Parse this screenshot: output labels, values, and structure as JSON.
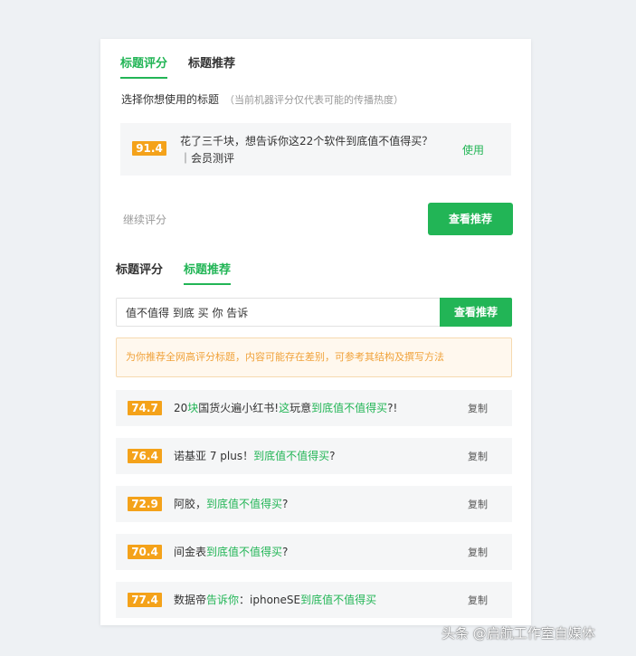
{
  "colors": {
    "accent": "#22b556",
    "score_badge": "#f4a21a",
    "notice_text": "#f0a23a"
  },
  "top_tabs": [
    {
      "label": "标题评分",
      "active": true
    },
    {
      "label": "标题推荐",
      "active": false
    }
  ],
  "select_prompt": "选择你想使用的标题",
  "select_hint": "（当前机器评分仅代表可能的传播热度）",
  "selected_title": {
    "score": "91.4",
    "text": "花了三千块，想告诉你这22个软件到底值不值得买？｜会员测评",
    "use_label": "使用"
  },
  "continue_label": "继续评分",
  "view_recommend_label": "查看推荐",
  "second_tabs": [
    {
      "label": "标题评分",
      "active": false
    },
    {
      "label": "标题推荐",
      "active": true
    }
  ],
  "search": {
    "value": "值不值得 到底 买 你 告诉",
    "button_label": "查看推荐"
  },
  "notice": "为你推荐全网高评分标题，内容可能存在差别，可参考其结构及撰写方法",
  "recommendations": [
    {
      "score": "74.7",
      "parts": [
        {
          "t": "20"
        },
        {
          "t": "块",
          "hl": true
        },
        {
          "t": "国货火遍小红书!"
        },
        {
          "t": "这",
          "hl": true
        },
        {
          "t": "玩意"
        },
        {
          "t": "到底值不值得买",
          "hl": true
        },
        {
          "t": "?!"
        }
      ],
      "copy_label": "复制"
    },
    {
      "score": "76.4",
      "parts": [
        {
          "t": "诺基亚 7 plus！"
        },
        {
          "t": "到底值不值得买",
          "hl": true
        },
        {
          "t": "?"
        }
      ],
      "copy_label": "复制"
    },
    {
      "score": "72.9",
      "parts": [
        {
          "t": "阿胶，"
        },
        {
          "t": "到底值不值得买",
          "hl": true
        },
        {
          "t": "?"
        }
      ],
      "copy_label": "复制"
    },
    {
      "score": "70.4",
      "parts": [
        {
          "t": "间金表"
        },
        {
          "t": "到底值不值得买",
          "hl": true
        },
        {
          "t": "?"
        }
      ],
      "copy_label": "复制"
    },
    {
      "score": "77.4",
      "parts": [
        {
          "t": "数据帝"
        },
        {
          "t": "告诉你",
          "hl": true
        },
        {
          "t": "：iphoneSE"
        },
        {
          "t": "到底值不值得买",
          "hl": true
        }
      ],
      "copy_label": "复制"
    }
  ],
  "watermark": "头条 @启航工作室自媒体"
}
